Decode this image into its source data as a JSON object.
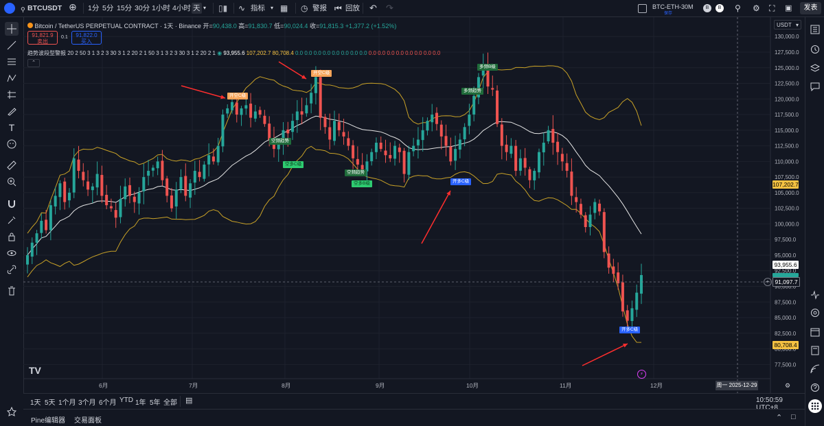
{
  "topbar": {
    "symbol": "BTCUSDT",
    "intervals": [
      "1分",
      "5分",
      "15分",
      "30分",
      "1小时",
      "4小时",
      "天"
    ],
    "selected_interval": "天",
    "indicators_label": "指标",
    "alert_label": "警报",
    "replay_label": "回放",
    "watch_symbol": "BTC-ETH-30M",
    "watch_sub": "保存",
    "publish_label": "发表"
  },
  "legend": {
    "title": "Bitcoin / TetherUS PERPETUAL CONTRACT · 1天 · Binance",
    "open_label": "开=",
    "open": "90,438.0",
    "high_label": "高=",
    "high": "91,830.7",
    "low_label": "低=",
    "low": "90,024.4",
    "close_label": "收=",
    "close": "91,815.3",
    "change": "+1,377.2 (+1.52%)",
    "sell_price": "91,821.9",
    "sell_label": "卖出",
    "spread": "0.1",
    "buy_price": "91,822.0",
    "buy_label": "买入",
    "indicator_name": "趋势波段型警报 20 2 50 3 1 3 2 3 30 3 1 2 20 2 1 50 3 1 3 2 3 30 3 1 2 20 2 1",
    "ind_v1": "93,955.6",
    "ind_v2": "107,202.7",
    "ind_v3": "80,708.4",
    "ind_zeros_green": "0.0 0.0 0.0 0.0 0.0 0.0 0.0 0.0",
    "ind_zeros_red": "0.0 0.0 0.0 0.0 0.0 0.0 0.0 0.0"
  },
  "price_axis": {
    "currency": "USDT",
    "labels": [
      "130,000.0",
      "127,500.0",
      "125,000.0",
      "122,500.0",
      "120,000.0",
      "117,500.0",
      "115,000.0",
      "112,500.0",
      "110,000.0",
      "107,500.0",
      "105,000.0",
      "102,500.0",
      "100,000.0",
      "97,500.0",
      "95,000.0",
      "92,500.0",
      "90,000.0",
      "87,500.0",
      "85,000.0",
      "82,500.0",
      "80,000.0",
      "77,500.0"
    ],
    "tag_upper": "107,202.7",
    "tag_mid": "93,955.6",
    "tag_current": "91,097.7",
    "tag_lower": "80,708.4",
    "tag_green": "91,815.3",
    "colors": {
      "upper": "#f5c242",
      "mid": "#ffffff",
      "current": "#131722",
      "lower": "#f5c242",
      "green": "#26a69a"
    }
  },
  "time_axis": {
    "labels": [
      "6月",
      "7月",
      "8月",
      "9月",
      "10月",
      "11月",
      "12月"
    ],
    "cursor_date": "周一 2025-12-29"
  },
  "signals": [
    {
      "text": "开空C级",
      "kind": "short"
    },
    {
      "text": "开空C级",
      "kind": "short"
    },
    {
      "text": "多频B级",
      "kind": "long-green"
    },
    {
      "text": "多频趋势",
      "kind": "long-green"
    },
    {
      "text": "空频趋势",
      "kind": "green"
    },
    {
      "text": "空多C级",
      "kind": "green"
    },
    {
      "text": "空频趋势",
      "kind": "green"
    },
    {
      "text": "空多B级",
      "kind": "green"
    },
    {
      "text": "开多C级",
      "kind": "long"
    },
    {
      "text": "开多C级",
      "kind": "long"
    }
  ],
  "bottombar": {
    "ranges": [
      "1天",
      "5天",
      "1个月",
      "3个月",
      "6个月",
      "YTD",
      "1年",
      "5年",
      "全部"
    ],
    "clock": "10:50:59 UTC+8"
  },
  "footer": {
    "tabs": [
      "Pine编辑器",
      "交易面板"
    ]
  },
  "chart_data": {
    "type": "candlestick",
    "ylim": [
      76000,
      132000
    ],
    "series_close": [
      95000,
      97000,
      98500,
      100500,
      99000,
      103000,
      104500,
      106500,
      103500,
      105000,
      110500,
      108500,
      107000,
      105500,
      106000,
      108000,
      104500,
      103000,
      102500,
      101000,
      104000,
      106000,
      104500,
      103500,
      105000,
      107500,
      108500,
      109000,
      110000,
      107000,
      104500,
      102500,
      105500,
      107500,
      104500,
      106500,
      108500,
      107500,
      109500,
      111000,
      110000,
      112500,
      117500,
      118500,
      119500,
      117500,
      118500,
      119000,
      117000,
      118000,
      117500,
      116000,
      113500,
      112000,
      113000,
      115000,
      114500,
      116500,
      118000,
      117500,
      119000,
      121000,
      123500,
      117000,
      115500,
      113500,
      116500,
      115000,
      114000,
      112500,
      110500,
      109500,
      108500,
      110000,
      111500,
      113000,
      112000,
      111000,
      110500,
      112500,
      111500,
      108000,
      111500,
      112500,
      113500,
      115000,
      116500,
      117500,
      116000,
      114000,
      112500,
      110000,
      112000,
      113500,
      115500,
      117500,
      120500,
      123500,
      125500,
      122000,
      121500,
      116000,
      112500,
      111500,
      112500,
      108500,
      110500,
      109000,
      107000,
      108500,
      111500,
      113000,
      115000,
      113000,
      111500,
      110000,
      108500,
      104500,
      103500,
      101500,
      99500,
      101500,
      103500,
      102000,
      95500,
      93000,
      92000,
      90500,
      86000,
      84500,
      86500,
      89000,
      91815
    ]
  },
  "legend_colors": {
    "up": "#26a69a",
    "down": "#ef5350",
    "band": "#c9a227",
    "mid": "#e6e6e6"
  }
}
